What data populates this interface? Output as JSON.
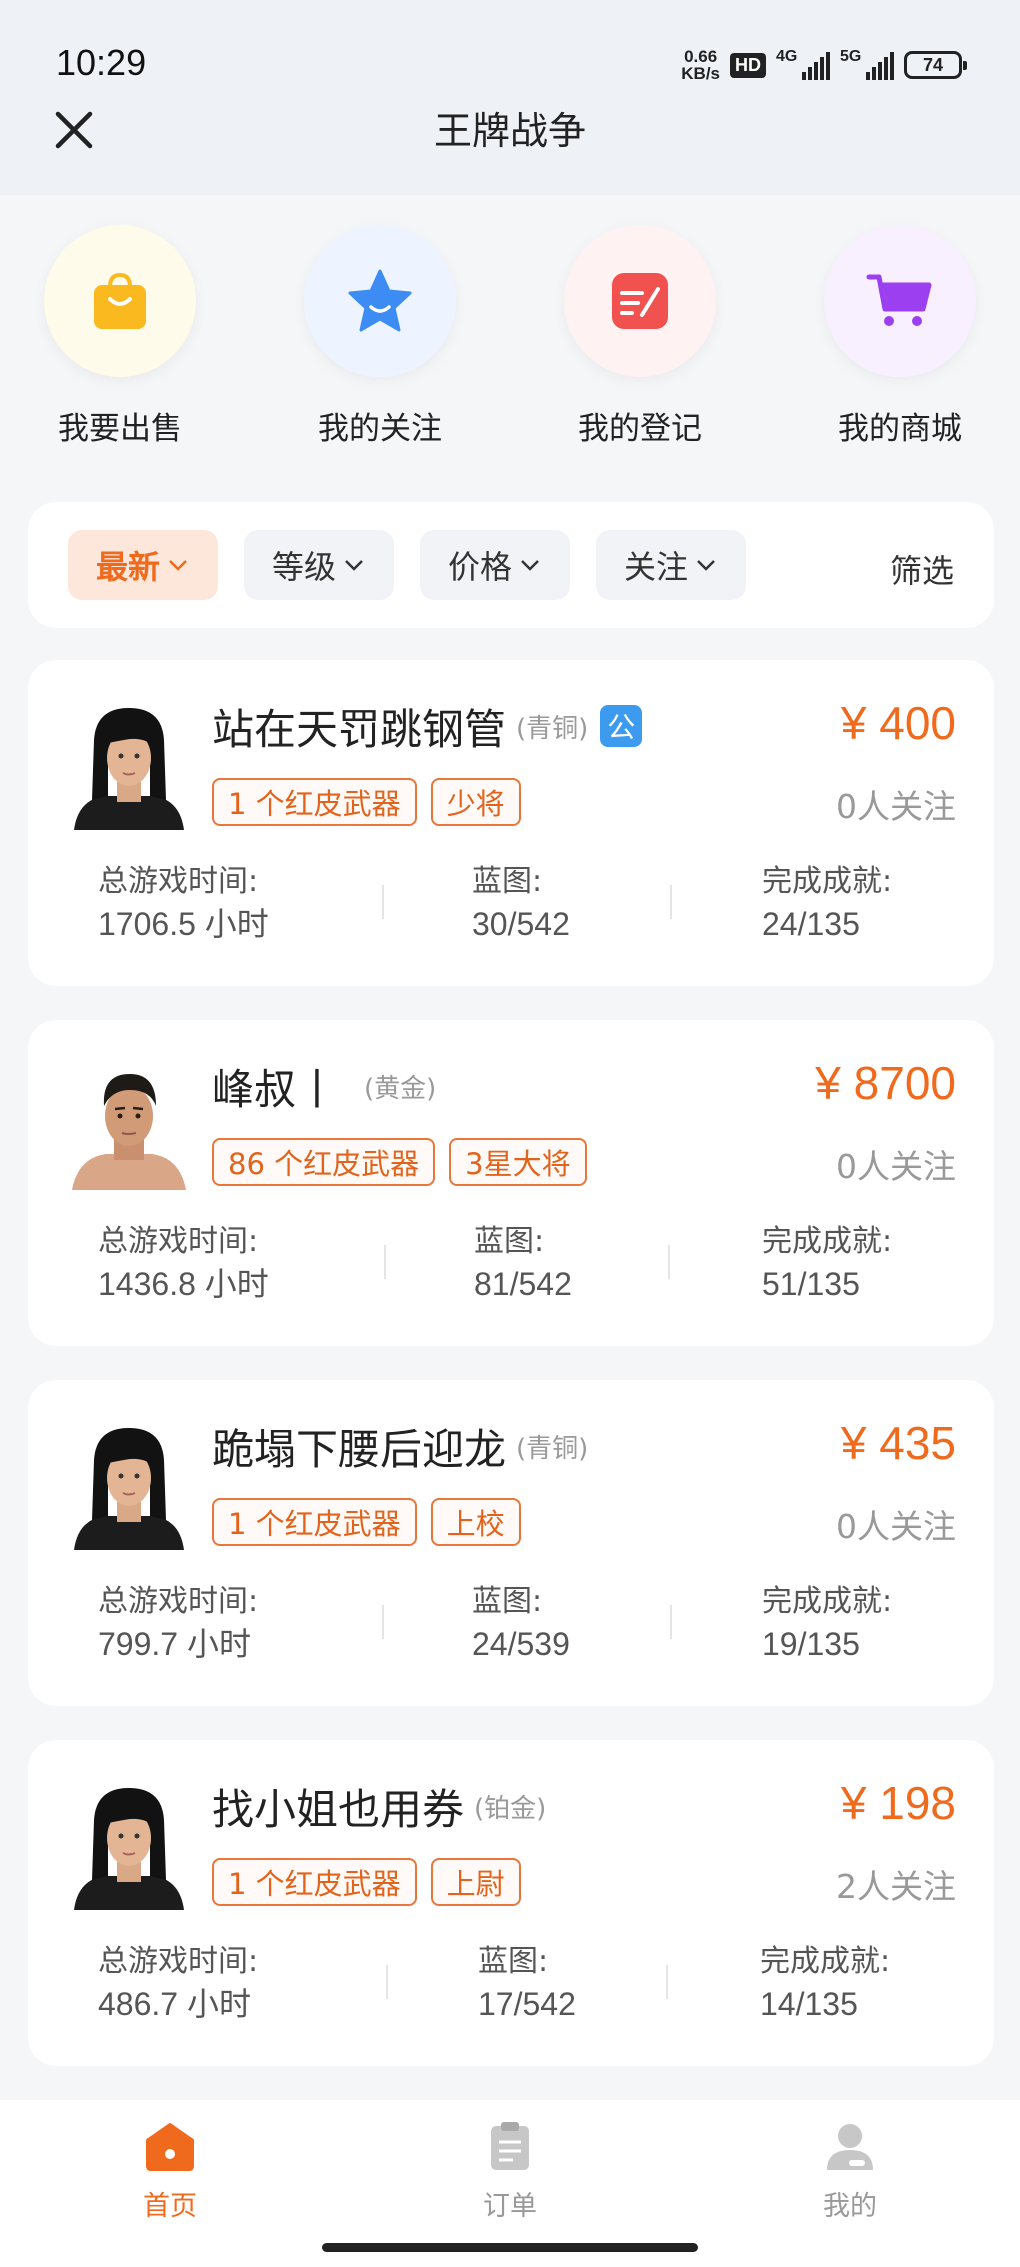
{
  "status_bar": {
    "time": "10:29",
    "net_speed_value": "0.66",
    "net_speed_unit": "KB/s",
    "hd_label": "HD",
    "signal1_label": "4G",
    "signal2_label": "5G",
    "battery": "74"
  },
  "header": {
    "title": "王牌战争",
    "close_icon": "close-icon"
  },
  "quick_actions": [
    {
      "label": "我要出售",
      "icon": "shopping-bag-icon",
      "color": "#f9b91f"
    },
    {
      "label": "我的关注",
      "icon": "star-icon",
      "color": "#3c8cf3"
    },
    {
      "label": "我的登记",
      "icon": "register-note-icon",
      "color": "#f1514f"
    },
    {
      "label": "我的商城",
      "icon": "shopping-cart-icon",
      "color": "#9b3ff0"
    }
  ],
  "filters": {
    "chips": [
      {
        "label": "最新",
        "active": true
      },
      {
        "label": "等级",
        "active": false
      },
      {
        "label": "价格",
        "active": false
      },
      {
        "label": "关注",
        "active": false
      }
    ],
    "filter_label": "筛选"
  },
  "listings": [
    {
      "name": "站在天罚跳钢管",
      "rank": "(青铜)",
      "badge": "公",
      "tags": [
        "1 个红皮武器",
        "少将"
      ],
      "price": "¥ 400",
      "follow": "0人关注",
      "avatar": "female-avatar",
      "stats": [
        {
          "label": "总游戏时间:",
          "value": "1706.5 小时"
        },
        {
          "label": "蓝图:",
          "value": "30/542"
        },
        {
          "label": "完成成就:",
          "value": "24/135"
        }
      ]
    },
    {
      "name": "峰叔丨",
      "rank": "(黄金)",
      "badge": "",
      "tags": [
        "86 个红皮武器",
        "3星大将"
      ],
      "price": "¥ 8700",
      "follow": "0人关注",
      "avatar": "male-avatar",
      "stats": [
        {
          "label": "总游戏时间:",
          "value": "1436.8 小时"
        },
        {
          "label": "蓝图:",
          "value": "81/542"
        },
        {
          "label": "完成成就:",
          "value": "51/135"
        }
      ]
    },
    {
      "name": "跪塌下腰后迎龙",
      "rank": "(青铜)",
      "badge": "",
      "tags": [
        "1 个红皮武器",
        "上校"
      ],
      "price": "¥ 435",
      "follow": "0人关注",
      "avatar": "female-avatar",
      "stats": [
        {
          "label": "总游戏时间:",
          "value": "799.7 小时"
        },
        {
          "label": "蓝图:",
          "value": "24/539"
        },
        {
          "label": "完成成就:",
          "value": "19/135"
        }
      ]
    },
    {
      "name": "找小姐也用券",
      "rank": "(铂金)",
      "badge": "",
      "tags": [
        "1 个红皮武器",
        "上尉"
      ],
      "price": "¥ 198",
      "follow": "2人关注",
      "avatar": "female-avatar",
      "stats": [
        {
          "label": "总游戏时间:",
          "value": "486.7 小时"
        },
        {
          "label": "蓝图:",
          "value": "17/542"
        },
        {
          "label": "完成成就:",
          "value": "14/135"
        }
      ]
    }
  ],
  "tabbar": [
    {
      "label": "首页",
      "icon": "home-icon",
      "active": true
    },
    {
      "label": "订单",
      "icon": "order-icon",
      "active": false
    },
    {
      "label": "我的",
      "icon": "profile-icon",
      "active": false
    }
  ],
  "colors": {
    "accent": "#f06a1d",
    "tag_border": "#e7773a",
    "blue_badge": "#3d9bef"
  }
}
